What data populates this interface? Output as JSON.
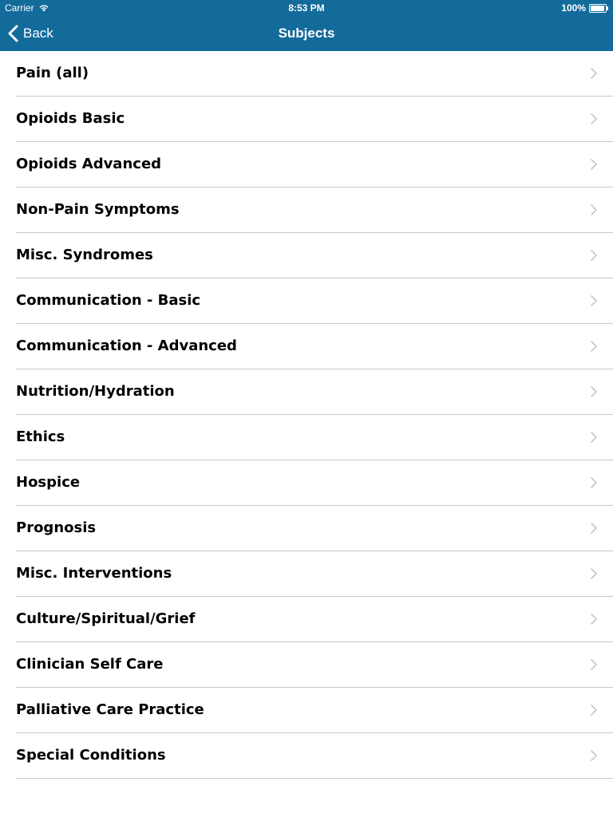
{
  "status_bar": {
    "carrier": "Carrier",
    "time": "8:53 PM",
    "battery": "100%",
    "wifi_icon": "wifi-icon",
    "battery_icon": "battery-icon"
  },
  "nav": {
    "back_label": "Back",
    "title": "Subjects",
    "background_color": "#136b9c"
  },
  "subjects": [
    {
      "label": "Pain (all)"
    },
    {
      "label": "Opioids Basic"
    },
    {
      "label": "Opioids Advanced"
    },
    {
      "label": "Non-Pain Symptoms"
    },
    {
      "label": "Misc. Syndromes"
    },
    {
      "label": "Communication - Basic"
    },
    {
      "label": "Communication - Advanced"
    },
    {
      "label": "Nutrition/Hydration"
    },
    {
      "label": "Ethics"
    },
    {
      "label": "Hospice"
    },
    {
      "label": "Prognosis"
    },
    {
      "label": "Misc. Interventions"
    },
    {
      "label": "Culture/Spiritual/Grief"
    },
    {
      "label": "Clinician Self Care"
    },
    {
      "label": "Palliative Care Practice"
    },
    {
      "label": "Special Conditions"
    }
  ]
}
